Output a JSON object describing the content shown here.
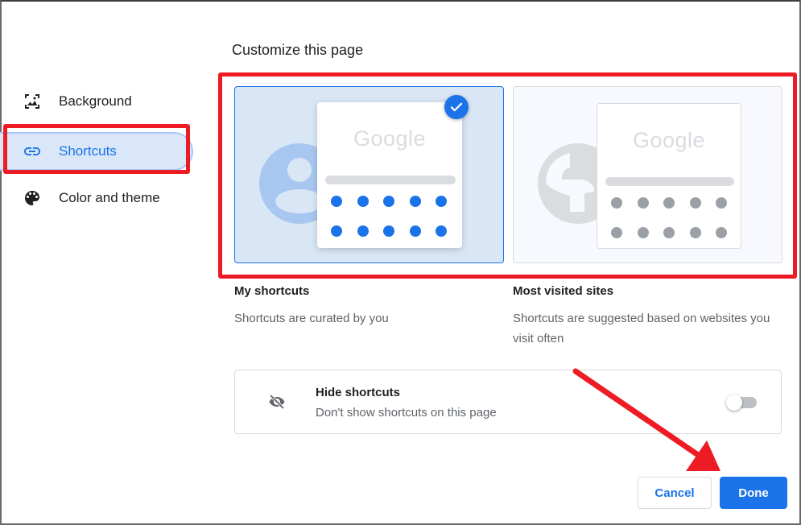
{
  "dialog": {
    "title": "Customize this page"
  },
  "sidebar": {
    "items": [
      {
        "label": "Background",
        "icon": "image-icon",
        "selected": false
      },
      {
        "label": "Shortcuts",
        "icon": "link-icon",
        "selected": true
      },
      {
        "label": "Color and theme",
        "icon": "palette-icon",
        "selected": false
      }
    ]
  },
  "shortcut_options": [
    {
      "title": "My shortcuts",
      "description": "Shortcuts are curated by you",
      "preview_logo": "Google",
      "background_icon": "account-icon",
      "selected": true
    },
    {
      "title": "Most visited sites",
      "description": "Shortcuts are suggested based on websites you visit often",
      "preview_logo": "Google",
      "background_icon": "globe-icon",
      "selected": false
    }
  ],
  "hide_shortcuts": {
    "title": "Hide shortcuts",
    "description": "Don't show shortcuts on this page",
    "icon": "eye-off-icon",
    "enabled": false
  },
  "buttons": {
    "cancel": "Cancel",
    "done": "Done"
  },
  "colors": {
    "accent": "#1a73e8",
    "selected_bg": "#d9e6f6",
    "annotation_red": "#ed1c24"
  }
}
